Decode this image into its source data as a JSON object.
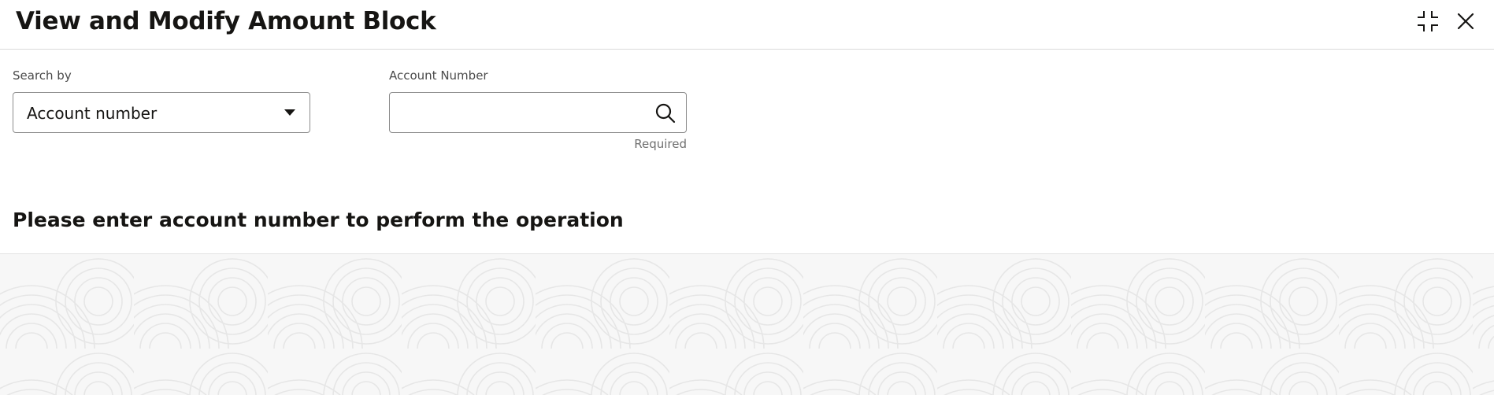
{
  "header": {
    "title": "View and Modify Amount Block",
    "minimize_icon": "minimize-icon",
    "close_icon": "close-icon"
  },
  "search_by": {
    "label": "Search by",
    "selected": "Account number",
    "icon": "caret-down-icon"
  },
  "account_number": {
    "label": "Account Number",
    "value": "",
    "helper": "Required",
    "icon": "search-icon"
  },
  "message": "Please enter account number to perform the operation",
  "colors": {
    "text": "#161513",
    "border": "#8c8c8c",
    "pattern_bg": "#f7f7f7",
    "pattern_line": "#e6e6e6"
  }
}
